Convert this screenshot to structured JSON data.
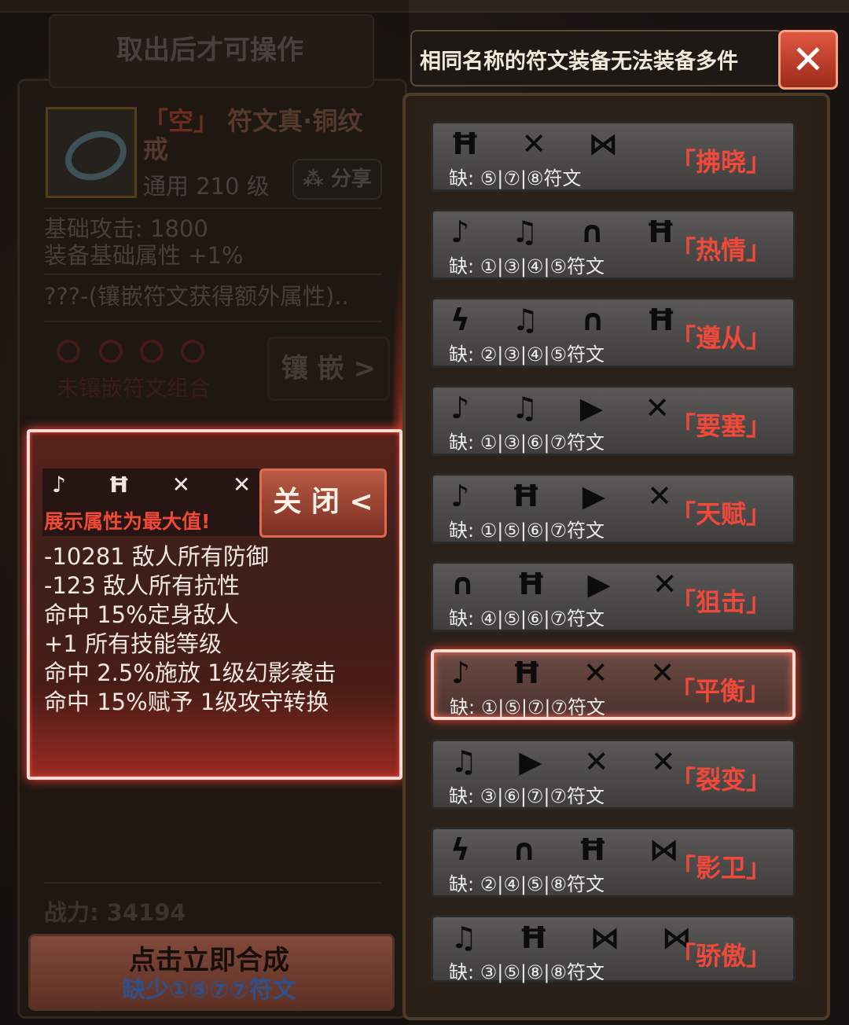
{
  "left": {
    "tab_title": "取出后才可操作",
    "item_name_prefix": "「空」",
    "item_name": "符文真·铜纹戒",
    "item_level": "通用 210 级",
    "share_label": "分享",
    "stats": [
      "基础攻击:  1800",
      "装备基础属性 +1%"
    ],
    "extra": "???-(镶嵌符文获得额外属性)..",
    "unset_text": "未镶嵌符文组合",
    "inlay_label": "镶 嵌 >",
    "power": "战力: 34194",
    "combine_title": "点击立即合成",
    "combine_missing": "缺少①⑤⑦⑦符文"
  },
  "popup": {
    "runes": "♪ Ħ ✕ ✕",
    "warning": "展示属性为最大值!",
    "close_label": "关 闭 <",
    "lines": [
      "-10281 敌人所有防御",
      "-123 敌人所有抗性",
      "命中 15%定身敌人",
      "+1 所有技能等级",
      "命中 2.5%施放 1级幻影袭击",
      "命中 15%赋予 1级攻守转换"
    ]
  },
  "right": {
    "header": "相同名称的符文装备无法装备多件",
    "close_icon": "✕",
    "cards": [
      {
        "runes": "Ħ ✕ ⋈",
        "missing": "缺:  ⑤|⑦|⑧符文",
        "name": "「拂晓」"
      },
      {
        "runes": "♪ ♫ ∩ Ħ",
        "missing": "缺:  ①|③|④|⑤符文",
        "name": "「热情」"
      },
      {
        "runes": "ϟ ♫ ∩ Ħ",
        "missing": "缺:  ②|③|④|⑤符文",
        "name": "「遵从」"
      },
      {
        "runes": "♪ ♫ ▶ ✕",
        "missing": "缺:  ①|③|⑥|⑦符文",
        "name": "「要塞」"
      },
      {
        "runes": "♪ Ħ ▶ ✕",
        "missing": "缺:  ①|⑤|⑥|⑦符文",
        "name": "「天赋」"
      },
      {
        "runes": "∩ Ħ ▶ ✕",
        "missing": "缺:  ④|⑤|⑥|⑦符文",
        "name": "「狙击」"
      },
      {
        "runes": "♪ Ħ ✕ ✕",
        "missing": "缺:  ①|⑤|⑦|⑦符文",
        "name": "「平衡」"
      },
      {
        "runes": "♫ ▶ ✕ ✕",
        "missing": "缺:  ③|⑥|⑦|⑦符文",
        "name": "「裂变」"
      },
      {
        "runes": "ϟ ∩ Ħ ⋈",
        "missing": "缺:  ②|④|⑤|⑧符文",
        "name": "「影卫」"
      },
      {
        "runes": "♫ Ħ ⋈ ⋈",
        "missing": "缺:  ③|⑤|⑧|⑧符文",
        "name": "「骄傲」"
      }
    ],
    "selected_index": 6
  }
}
